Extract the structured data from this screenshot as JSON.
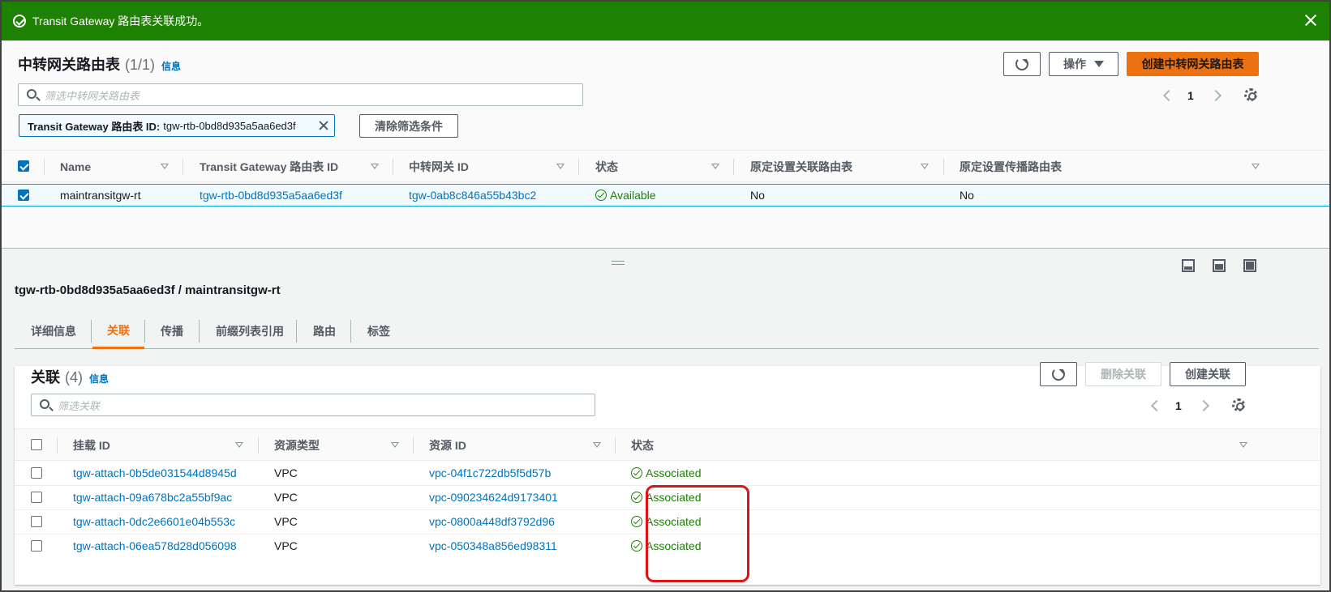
{
  "banner": {
    "message": "Transit Gateway 路由表关联成功。"
  },
  "top": {
    "title": "中转网关路由表",
    "count": "(1/1)",
    "info": "信息",
    "actions_label": "操作",
    "create_label": "创建中转网关路由表",
    "search_placeholder": "筛选中转网关路由表",
    "page": "1",
    "filter_key": "Transit Gateway 路由表 ID:",
    "filter_value": "tgw-rtb-0bd8d935a5aa6ed3f",
    "clear_label": "清除筛选条件",
    "columns": [
      "Name",
      "Transit Gateway 路由表 ID",
      "中转网关 ID",
      "状态",
      "原定设置关联路由表",
      "原定设置传播路由表"
    ],
    "row": {
      "name": "maintransitgw-rt",
      "rtb_id": "tgw-rtb-0bd8d935a5aa6ed3f",
      "tgw_id": "tgw-0ab8c846a55b43bc2",
      "state": "Available",
      "default_assoc": "No",
      "default_prop": "No"
    }
  },
  "detail": {
    "title": "tgw-rtb-0bd8d935a5aa6ed3f / maintransitgw-rt",
    "tabs": [
      "详细信息",
      "关联",
      "传播",
      "前缀列表引用",
      "路由",
      "标签"
    ],
    "active_tab": "关联"
  },
  "assoc": {
    "title": "关联",
    "count": "(4)",
    "info": "信息",
    "delete_label": "删除关联",
    "create_label": "创建关联",
    "search_placeholder": "筛选关联",
    "page": "1",
    "columns": [
      "挂载 ID",
      "资源类型",
      "资源 ID",
      "状态"
    ],
    "rows": [
      {
        "attach": "tgw-attach-0b5de031544d8945d",
        "type": "VPC",
        "res": "vpc-04f1c722db5f5d57b",
        "state": "Associated"
      },
      {
        "attach": "tgw-attach-09a678bc2a55bf9ac",
        "type": "VPC",
        "res": "vpc-090234624d9173401",
        "state": "Associated"
      },
      {
        "attach": "tgw-attach-0dc2e6601e04b553c",
        "type": "VPC",
        "res": "vpc-0800a448df3792d96",
        "state": "Associated"
      },
      {
        "attach": "tgw-attach-06ea578d28d056098",
        "type": "VPC",
        "res": "vpc-050348a856ed98311",
        "state": "Associated"
      }
    ]
  },
  "colors": {
    "success": "#1d8102",
    "primary": "#ec7211",
    "link": "#0073bb",
    "highlight": "#d91515"
  }
}
